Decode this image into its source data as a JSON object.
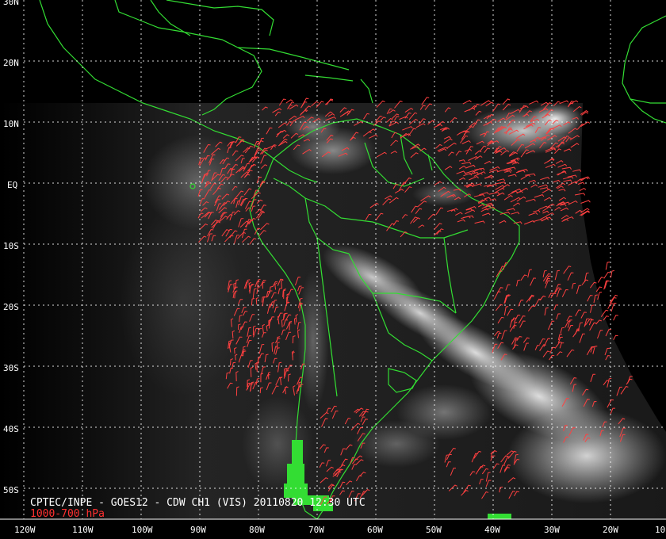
{
  "caption": {
    "line1": "CPTEC/INPE - GOES12 - CDW CH1 (VIS) 20110820 12:30 UTC",
    "line2": "1000-700 hPa"
  },
  "lat_labels": [
    "30N",
    "20N",
    "10N",
    "EQ",
    "10S",
    "20S",
    "30S",
    "40S",
    "50S"
  ],
  "lon_labels": [
    "120W",
    "110W",
    "100W",
    "90W",
    "80W",
    "70W",
    "60W",
    "50W",
    "40W",
    "30W",
    "20W",
    "10"
  ],
  "colors": {
    "coast": "#33dd33",
    "wind": "#ff4040",
    "grid": "#ffffff",
    "caption_line1": "#ffffff",
    "caption_line2": "#ff3030"
  }
}
